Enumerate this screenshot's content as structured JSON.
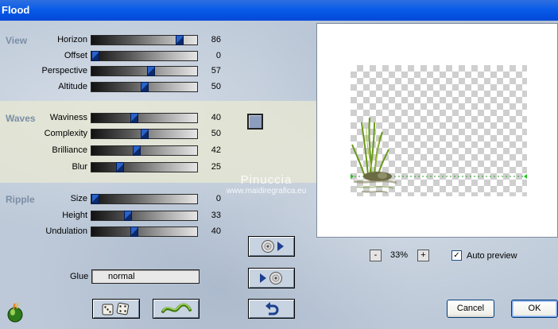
{
  "window": {
    "title": "Flood"
  },
  "sections": {
    "view": "View",
    "waves": "Waves",
    "ripple": "Ripple"
  },
  "sliders": {
    "horizon": {
      "label": "Horizon",
      "value": 86
    },
    "offset": {
      "label": "Offset",
      "value": 0
    },
    "perspective": {
      "label": "Perspective",
      "value": 57
    },
    "altitude": {
      "label": "Altitude",
      "value": 50
    },
    "waviness": {
      "label": "Waviness",
      "value": 40
    },
    "complexity": {
      "label": "Complexity",
      "value": 50
    },
    "brilliance": {
      "label": "Brilliance",
      "value": 42
    },
    "blur": {
      "label": "Blur",
      "value": 25
    },
    "size": {
      "label": "Size",
      "value": 0
    },
    "height": {
      "label": "Height",
      "value": 33
    },
    "undulation": {
      "label": "Undulation",
      "value": 40
    }
  },
  "color_swatch": "#8c9dbd",
  "glue": {
    "label": "Glue",
    "value": "normal"
  },
  "watermark": {
    "line1": "Pinuccia",
    "line2": "www.maidiregrafica.eu"
  },
  "zoom": {
    "minus": "-",
    "value": "33%",
    "plus": "+"
  },
  "auto_preview": {
    "label": "Auto preview",
    "checked": true,
    "mark": "✓"
  },
  "buttons": {
    "cancel": "Cancel",
    "ok": "OK"
  },
  "icons": {
    "random": "dice-icon",
    "reset_wave": "wave-icon",
    "undo": "undo-arrow-icon",
    "load_preset": "disc-right-icon",
    "save_preset": "disc-left-icon",
    "logo": "flaming-pear-icon"
  }
}
